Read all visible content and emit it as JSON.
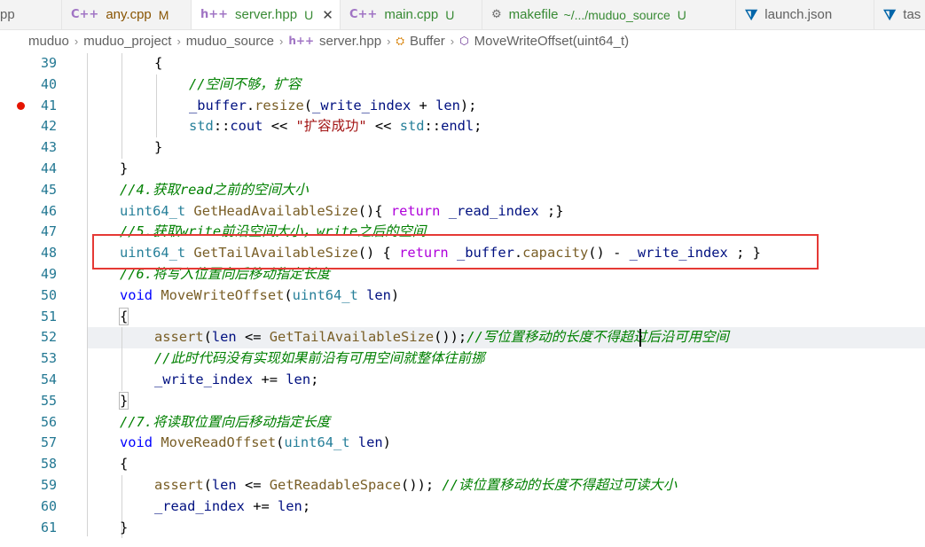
{
  "tabs": [
    {
      "label": "pp",
      "icon": "",
      "status": "",
      "active": false
    },
    {
      "label": "any.cpp",
      "icon": "C++",
      "status": "M",
      "active": false
    },
    {
      "label": "server.hpp",
      "icon": "h++",
      "status": "U",
      "active": true
    },
    {
      "label": "main.cpp",
      "icon": "C++",
      "status": "U",
      "active": false
    },
    {
      "label": "makefile",
      "icon": "makefile-icon",
      "path": "~/.../muduo_source",
      "status": "U",
      "active": false
    },
    {
      "label": "launch.json",
      "icon": "vscode-icon",
      "status": "",
      "active": false
    },
    {
      "label": "tas",
      "icon": "vscode-icon",
      "status": "",
      "active": false
    }
  ],
  "breadcrumb": [
    "muduo",
    "muduo_project",
    "muduo_source",
    "server.hpp",
    "Buffer",
    "MoveWriteOffset(uint64_t)"
  ],
  "breadcrumb_icons": {
    "file": "h++",
    "class": "Buffer-class-icon",
    "method": "method-cube-icon"
  },
  "lines": [
    {
      "n": "39"
    },
    {
      "n": "40"
    },
    {
      "n": "41"
    },
    {
      "n": "42"
    },
    {
      "n": "43"
    },
    {
      "n": "44"
    },
    {
      "n": "45"
    },
    {
      "n": "46"
    },
    {
      "n": "47"
    },
    {
      "n": "48"
    },
    {
      "n": "49"
    },
    {
      "n": "50"
    },
    {
      "n": "51"
    },
    {
      "n": "52"
    },
    {
      "n": "53"
    },
    {
      "n": "54"
    },
    {
      "n": "55"
    },
    {
      "n": "56"
    },
    {
      "n": "57"
    },
    {
      "n": "58"
    },
    {
      "n": "59"
    },
    {
      "n": "60"
    },
    {
      "n": "61"
    }
  ],
  "code": {
    "l39": "{",
    "l40": "//空间不够，扩容",
    "l41": [
      "_buffer",
      ".",
      "resize",
      "(",
      "_write_index",
      " + ",
      "len",
      ");"
    ],
    "l42": [
      "std",
      "::",
      "cout",
      " << ",
      "\"扩容成功\"",
      " << ",
      "std",
      "::",
      "endl",
      ";"
    ],
    "l43": "}",
    "l44": "}",
    "l45": "//4.获取read之前的空间大小",
    "l46": [
      "uint64_t",
      " ",
      "GetHeadAvailableSize",
      "(){ ",
      "return",
      " ",
      "_read_index",
      " ;}"
    ],
    "l47": "//5.获取write前沿空间大小，write之后的空间",
    "l48": [
      "uint64_t",
      " ",
      "GetTailAvailableSize",
      "() { ",
      "return",
      " ",
      "_buffer",
      ".",
      "capacity",
      "() - ",
      "_write_index",
      " ; }"
    ],
    "l49": "//6.将写入位置向后移动指定长度",
    "l50": [
      "void",
      " ",
      "MoveWriteOffset",
      "(",
      "uint64_t",
      " ",
      "len",
      ")"
    ],
    "l51": "{",
    "l52": [
      "assert",
      "(",
      "len",
      " <= ",
      "GetTailAvailableSize",
      "());",
      "//写位置移动的长度不得超过后沿可用空间"
    ],
    "l53": "//此时代码没有实现如果前沿有可用空间就整体往前挪",
    "l54": [
      "_write_index",
      " += ",
      "len",
      ";"
    ],
    "l55": "}",
    "l56": "//7.将读取位置向后移动指定长度",
    "l57": [
      "void",
      " ",
      "MoveReadOffset",
      "(",
      "uint64_t",
      " ",
      "len",
      ")"
    ],
    "l58": "{",
    "l59": [
      "assert",
      "(",
      "len",
      " <= ",
      "GetReadableSpace",
      "()); ",
      "//读位置移动的长度不得超过可读大小"
    ],
    "l60": [
      "_read_index",
      " += ",
      "len",
      ";"
    ],
    "l61": "}"
  },
  "breakpoint_line": "41",
  "colors": {
    "breakpoint": "#e51400",
    "highlight_box": "#e53935",
    "keyword": "#0000ff",
    "type": "#267f99",
    "function": "#795e26",
    "variable": "#001080",
    "comment": "#008000",
    "string": "#a31515",
    "line_number": "#237893"
  }
}
